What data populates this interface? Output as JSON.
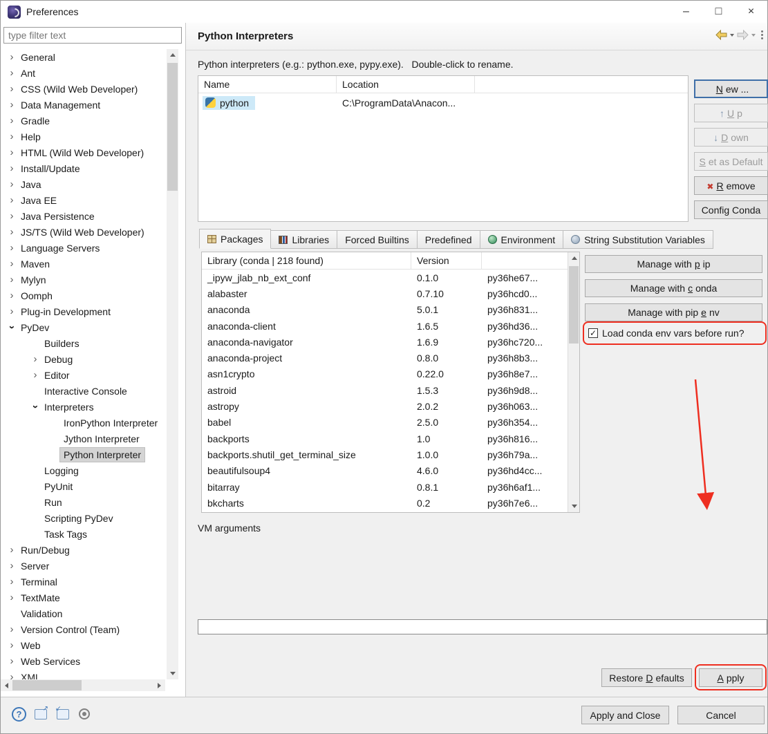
{
  "window": {
    "title": "Preferences",
    "controls": {
      "minimize": "–",
      "maximize": "□",
      "close": "×"
    }
  },
  "colors": {
    "annotation_red": "#ee2e20",
    "selection_blue": "#cde9f8",
    "tree_selection_gray": "#d4d4d4",
    "default_button_border": "#3f6fa8"
  },
  "sidebar": {
    "filter_placeholder": "type filter text",
    "tree": [
      {
        "label": "General",
        "level": 0,
        "state": "collapsed"
      },
      {
        "label": "Ant",
        "level": 0,
        "state": "collapsed"
      },
      {
        "label": "CSS (Wild Web Developer)",
        "level": 0,
        "state": "collapsed"
      },
      {
        "label": "Data Management",
        "level": 0,
        "state": "collapsed"
      },
      {
        "label": "Gradle",
        "level": 0,
        "state": "collapsed"
      },
      {
        "label": "Help",
        "level": 0,
        "state": "collapsed"
      },
      {
        "label": "HTML (Wild Web Developer)",
        "level": 0,
        "state": "collapsed"
      },
      {
        "label": "Install/Update",
        "level": 0,
        "state": "collapsed"
      },
      {
        "label": "Java",
        "level": 0,
        "state": "collapsed"
      },
      {
        "label": "Java EE",
        "level": 0,
        "state": "collapsed"
      },
      {
        "label": "Java Persistence",
        "level": 0,
        "state": "collapsed"
      },
      {
        "label": "JS/TS (Wild Web Developer)",
        "level": 0,
        "state": "collapsed"
      },
      {
        "label": "Language Servers",
        "level": 0,
        "state": "collapsed"
      },
      {
        "label": "Maven",
        "level": 0,
        "state": "collapsed"
      },
      {
        "label": "Mylyn",
        "level": 0,
        "state": "collapsed"
      },
      {
        "label": "Oomph",
        "level": 0,
        "state": "collapsed"
      },
      {
        "label": "Plug-in Development",
        "level": 0,
        "state": "collapsed"
      },
      {
        "label": "PyDev",
        "level": 0,
        "state": "expanded"
      },
      {
        "label": "Builders",
        "level": 1,
        "state": "none"
      },
      {
        "label": "Debug",
        "level": 1,
        "state": "collapsed"
      },
      {
        "label": "Editor",
        "level": 1,
        "state": "collapsed"
      },
      {
        "label": "Interactive Console",
        "level": 1,
        "state": "none"
      },
      {
        "label": "Interpreters",
        "level": 1,
        "state": "expanded"
      },
      {
        "label": "IronPython Interpreter",
        "level": 2,
        "state": "none"
      },
      {
        "label": "Jython Interpreter",
        "level": 2,
        "state": "none"
      },
      {
        "label": "Python Interpreter",
        "level": 2,
        "state": "none",
        "selected": true
      },
      {
        "label": "Logging",
        "level": 1,
        "state": "none"
      },
      {
        "label": "PyUnit",
        "level": 1,
        "state": "none"
      },
      {
        "label": "Run",
        "level": 1,
        "state": "none"
      },
      {
        "label": "Scripting PyDev",
        "level": 1,
        "state": "none"
      },
      {
        "label": "Task Tags",
        "level": 1,
        "state": "none"
      },
      {
        "label": "Run/Debug",
        "level": 0,
        "state": "collapsed"
      },
      {
        "label": "Server",
        "level": 0,
        "state": "collapsed"
      },
      {
        "label": "Terminal",
        "level": 0,
        "state": "collapsed"
      },
      {
        "label": "TextMate",
        "level": 0,
        "state": "collapsed"
      },
      {
        "label": "Validation",
        "level": 0,
        "state": "none"
      },
      {
        "label": "Version Control (Team)",
        "level": 0,
        "state": "collapsed"
      },
      {
        "label": "Web",
        "level": 0,
        "state": "collapsed"
      },
      {
        "label": "Web Services",
        "level": 0,
        "state": "collapsed"
      },
      {
        "label": "XML",
        "level": 0,
        "state": "collapsed"
      }
    ]
  },
  "header": {
    "title": "Python Interpreters",
    "nav_icons": [
      "back-icon",
      "back-history-dropdown-icon",
      "forward-icon",
      "forward-history-dropdown-icon",
      "view-menu-icon"
    ]
  },
  "description": "Python interpreters (e.g.: python.exe, pypy.exe).   Double-click to rename.",
  "interpreters_table": {
    "columns": [
      "Name",
      "Location"
    ],
    "rows": [
      {
        "name": "python",
        "location": "C:\\ProgramData\\Anacon...",
        "icon": "python-icon",
        "selected": true
      }
    ]
  },
  "side_buttons": [
    {
      "pre": "",
      "key": "N",
      "post": "ew ...",
      "enabled": true,
      "default": true
    },
    {
      "pre": "",
      "key": "U",
      "post": "p",
      "enabled": false,
      "icon": "up-arrow-icon"
    },
    {
      "pre": "",
      "key": "D",
      "post": "own",
      "enabled": false,
      "icon": "down-arrow-icon"
    },
    {
      "pre": "",
      "key": "S",
      "post": "et as Default",
      "enabled": false
    },
    {
      "pre": "",
      "key": "R",
      "post": "emove",
      "enabled": true,
      "icon": "remove-x-icon"
    },
    {
      "pre": "Config Conda",
      "key": "",
      "post": "",
      "enabled": true
    }
  ],
  "tabs": [
    {
      "label": "Packages",
      "icon": "packages-icon",
      "active": true
    },
    {
      "label": "Libraries",
      "icon": "libraries-icon",
      "active": false
    },
    {
      "label": "Forced Builtins",
      "active": false
    },
    {
      "label": "Predefined",
      "active": false
    },
    {
      "label": "Environment",
      "icon": "environment-icon",
      "active": false
    },
    {
      "label": "String Substitution Variables",
      "icon": "variables-icon",
      "active": false
    }
  ],
  "packages": {
    "header": {
      "library": "Library (conda | 218 found)",
      "version": "Version"
    },
    "rows": [
      [
        "_ipyw_jlab_nb_ext_conf",
        "0.1.0",
        "py36he67..."
      ],
      [
        "alabaster",
        "0.7.10",
        "py36hcd0..."
      ],
      [
        "anaconda",
        "5.0.1",
        "py36h831..."
      ],
      [
        "anaconda-client",
        "1.6.5",
        "py36hd36..."
      ],
      [
        "anaconda-navigator",
        "1.6.9",
        "py36hc720..."
      ],
      [
        "anaconda-project",
        "0.8.0",
        "py36h8b3..."
      ],
      [
        "asn1crypto",
        "0.22.0",
        "py36h8e7..."
      ],
      [
        "astroid",
        "1.5.3",
        "py36h9d8..."
      ],
      [
        "astropy",
        "2.0.2",
        "py36h063..."
      ],
      [
        "babel",
        "2.5.0",
        "py36h354..."
      ],
      [
        "backports",
        "1.0",
        "py36h816..."
      ],
      [
        "backports.shutil_get_terminal_size",
        "1.0.0",
        "py36h79a..."
      ],
      [
        "beautifulsoup4",
        "4.6.0",
        "py36hd4cc..."
      ],
      [
        "bitarray",
        "0.8.1",
        "py36h6af1..."
      ],
      [
        "bkcharts",
        "0.2",
        "py36h7e6..."
      ]
    ]
  },
  "manage_buttons": [
    {
      "pre": "Manage with ",
      "key": "p",
      "post": "ip"
    },
    {
      "pre": "Manage with ",
      "key": "c",
      "post": "onda"
    },
    {
      "pre": "Manage with pip",
      "key": "e",
      "post": "nv"
    }
  ],
  "conda_checkbox": {
    "label": "Load conda env vars before run?",
    "checked": true,
    "check_glyph": "✓"
  },
  "vm_arguments": {
    "label": "VM arguments",
    "value": ""
  },
  "footer": {
    "restore_defaults": {
      "pre": "Restore ",
      "key": "D",
      "post": "efaults"
    },
    "apply": {
      "pre": "",
      "key": "A",
      "post": "pply"
    },
    "apply_and_close": "Apply and Close",
    "cancel": "Cancel"
  },
  "annotations": {
    "arrow": "red-arrow-down",
    "highlight_color": "#ee2e20"
  }
}
